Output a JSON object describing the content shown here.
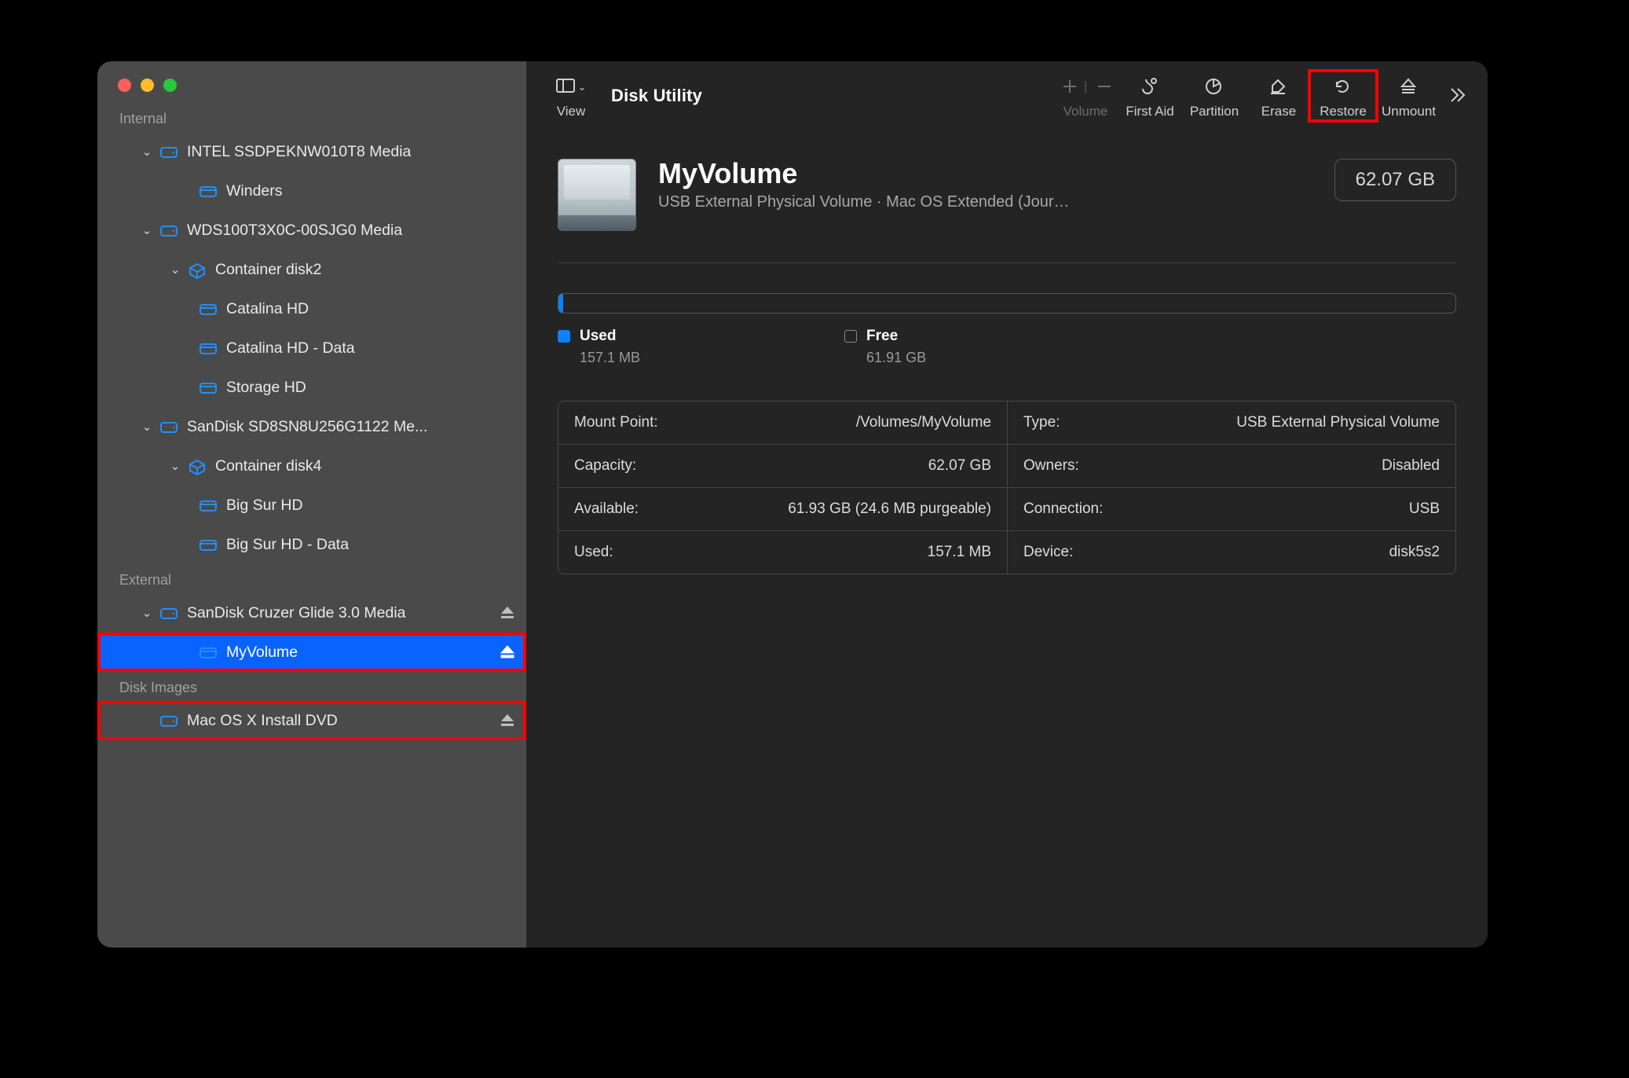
{
  "app": {
    "title": "Disk Utility"
  },
  "toolbar": {
    "view": "View",
    "volume": "Volume",
    "first_aid": "First Aid",
    "partition": "Partition",
    "erase": "Erase",
    "restore": "Restore",
    "unmount": "Unmount"
  },
  "sidebar": {
    "sections": {
      "internal": "Internal",
      "external": "External",
      "disk_images": "Disk Images"
    },
    "internal": [
      {
        "label": "INTEL SSDPEKNW010T8 Media",
        "icon": "disk",
        "indent": 1,
        "chev": "down"
      },
      {
        "label": "Winders",
        "icon": "volume",
        "indent": 3
      },
      {
        "label": "WDS100T3X0C-00SJG0 Media",
        "icon": "disk",
        "indent": 1,
        "chev": "down"
      },
      {
        "label": "Container disk2",
        "icon": "container",
        "indent": 2,
        "chev": "down"
      },
      {
        "label": "Catalina HD",
        "icon": "volume",
        "indent": 3
      },
      {
        "label": "Catalina HD - Data",
        "icon": "volume",
        "indent": 3
      },
      {
        "label": "Storage HD",
        "icon": "volume",
        "indent": 3
      },
      {
        "label": "SanDisk SD8SN8U256G1122 Me...",
        "icon": "disk",
        "indent": 1,
        "chev": "down"
      },
      {
        "label": "Container disk4",
        "icon": "container",
        "indent": 2,
        "chev": "down"
      },
      {
        "label": "Big Sur HD",
        "icon": "volume",
        "indent": 3
      },
      {
        "label": "Big Sur HD - Data",
        "icon": "volume",
        "indent": 3
      }
    ],
    "external": [
      {
        "label": "SanDisk Cruzer Glide 3.0 Media",
        "icon": "disk",
        "indent": 1,
        "chev": "down",
        "eject": true
      },
      {
        "label": "MyVolume",
        "icon": "volume",
        "indent": 3,
        "eject": true,
        "selected": true,
        "highlight": true
      }
    ],
    "disk_images": [
      {
        "label": "Mac OS X Install DVD",
        "icon": "disk",
        "indent": 1,
        "eject": true,
        "highlight": true
      }
    ]
  },
  "volume": {
    "name": "MyVolume",
    "subtitle": "USB External Physical Volume · Mac OS Extended (Jour…",
    "size": "62.07 GB"
  },
  "usage": {
    "used_label": "Used",
    "used_value": "157.1 MB",
    "free_label": "Free",
    "free_value": "61.91 GB"
  },
  "info": {
    "mount_point_k": "Mount Point:",
    "mount_point_v": "/Volumes/MyVolume",
    "type_k": "Type:",
    "type_v": "USB External Physical Volume",
    "capacity_k": "Capacity:",
    "capacity_v": "62.07 GB",
    "owners_k": "Owners:",
    "owners_v": "Disabled",
    "available_k": "Available:",
    "available_v": "61.93 GB (24.6 MB purgeable)",
    "connection_k": "Connection:",
    "connection_v": "USB",
    "used_k": "Used:",
    "used_v": "157.1 MB",
    "device_k": "Device:",
    "device_v": "disk5s2"
  }
}
